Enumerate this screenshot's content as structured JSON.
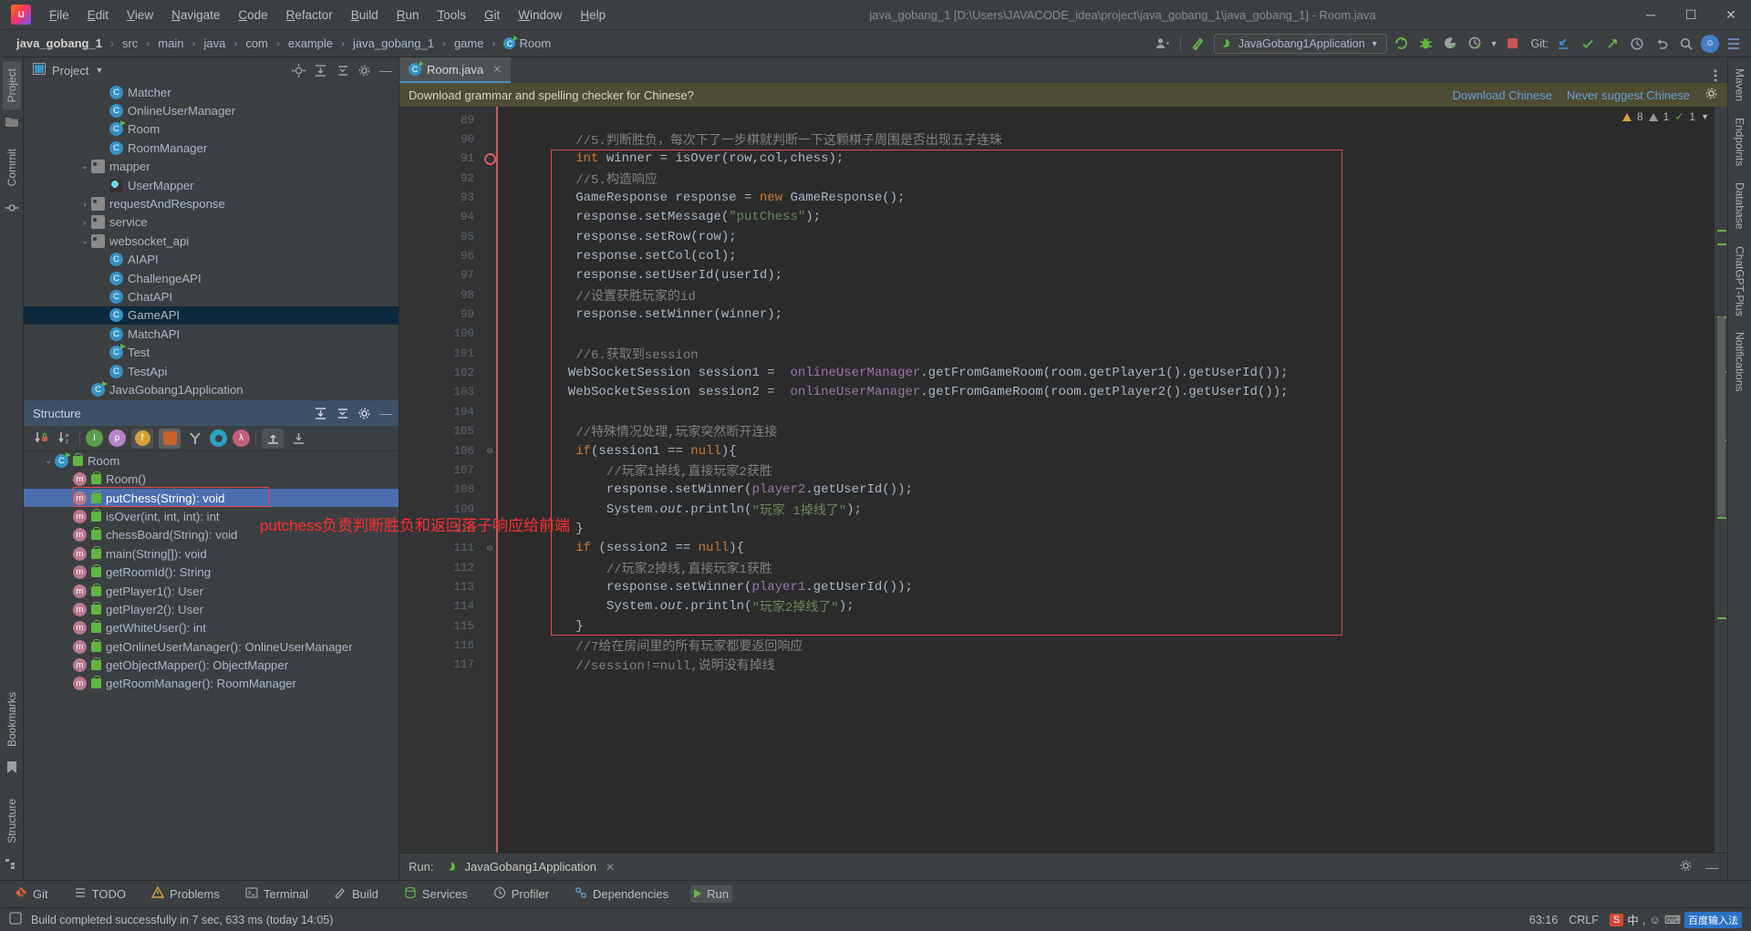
{
  "titlebar": {
    "logo": "intellij-idea-logo",
    "menus": [
      "File",
      "Edit",
      "View",
      "Navigate",
      "Code",
      "Refactor",
      "Build",
      "Run",
      "Tools",
      "Git",
      "Window",
      "Help"
    ],
    "window_title": "java_gobang_1 [D:\\Users\\JAVACODE_idea\\project\\java_gobang_1\\java_gobang_1] - Room.java",
    "minimize": "─",
    "maximize": "☐",
    "close": "✕"
  },
  "navbar": {
    "breadcrumbs": [
      "java_gobang_1",
      "src",
      "main",
      "java",
      "com",
      "example",
      "java_gobang_1",
      "game",
      "Room"
    ],
    "separator": "›",
    "run_config": "JavaGobang1Application",
    "git_label": "Git:",
    "avatar_initial": "☺"
  },
  "project_panel": {
    "title": "Project",
    "items": [
      {
        "label": "Matcher",
        "icon": "class-icon",
        "indent": 4,
        "chevron": ""
      },
      {
        "label": "OnlineUserManager",
        "icon": "class-icon",
        "indent": 4,
        "chevron": ""
      },
      {
        "label": "Room",
        "icon": "class-runnable-icon",
        "indent": 4,
        "chevron": ""
      },
      {
        "label": "RoomManager",
        "icon": "class-icon",
        "indent": 4,
        "chevron": ""
      },
      {
        "label": "mapper",
        "icon": "folder-icon",
        "indent": 3,
        "chevron": "⌄"
      },
      {
        "label": "UserMapper",
        "icon": "mapper-icon",
        "indent": 4,
        "chevron": ""
      },
      {
        "label": "requestAndResponse",
        "icon": "folder-icon",
        "indent": 3,
        "chevron": "›"
      },
      {
        "label": "service",
        "icon": "folder-icon",
        "indent": 3,
        "chevron": "›"
      },
      {
        "label": "websocket_api",
        "icon": "folder-icon",
        "indent": 3,
        "chevron": "⌄"
      },
      {
        "label": "AIAPI",
        "icon": "class-icon",
        "indent": 4,
        "chevron": ""
      },
      {
        "label": "ChallengeAPI",
        "icon": "class-icon",
        "indent": 4,
        "chevron": ""
      },
      {
        "label": "ChatAPI",
        "icon": "class-icon",
        "indent": 4,
        "chevron": ""
      },
      {
        "label": "GameAPI",
        "icon": "class-icon",
        "indent": 4,
        "chevron": "",
        "selected": true
      },
      {
        "label": "MatchAPI",
        "icon": "class-icon",
        "indent": 4,
        "chevron": ""
      },
      {
        "label": "Test",
        "icon": "class-runnable-icon",
        "indent": 4,
        "chevron": ""
      },
      {
        "label": "TestApi",
        "icon": "class-icon",
        "indent": 4,
        "chevron": ""
      },
      {
        "label": "JavaGobang1Application",
        "icon": "spring-class-icon",
        "indent": 3,
        "chevron": ""
      }
    ]
  },
  "structure_panel": {
    "title": "Structure",
    "toolbar_icons": [
      "sort-by-visibility-icon",
      "sort-alphabetically-icon",
      "show-inherited-icon",
      "show-properties-icon",
      "show-fields-icon",
      "show-non-public-icon",
      "group-by-icon",
      "show-interfaces-icon",
      "show-lambdas-icon",
      "expand-all-icon",
      "collapse-all-icon"
    ],
    "items": [
      {
        "label": "Room",
        "icon": "class-runnable-icon",
        "indent": 1,
        "chevron": "⌄",
        "lock": true
      },
      {
        "label": "Room()",
        "icon": "method-icon",
        "indent": 2,
        "lock": true
      },
      {
        "label": "putChess(String): void",
        "icon": "method-icon",
        "indent": 2,
        "lock": true,
        "selected": true,
        "highlight_box": true
      },
      {
        "label": "isOver(int, int, int): int",
        "icon": "method-icon",
        "indent": 2,
        "lock": true
      },
      {
        "label": "chessBoard(String): void",
        "icon": "method-icon",
        "indent": 2,
        "lock": true
      },
      {
        "label": "main(String[]): void",
        "icon": "method-icon",
        "indent": 2,
        "lock": true
      },
      {
        "label": "getRoomId(): String",
        "icon": "method-icon",
        "indent": 2,
        "lock": true
      },
      {
        "label": "getPlayer1(): User",
        "icon": "method-icon",
        "indent": 2,
        "lock": true
      },
      {
        "label": "getPlayer2(): User",
        "icon": "method-icon",
        "indent": 2,
        "lock": true
      },
      {
        "label": "getWhiteUser(): int",
        "icon": "method-icon",
        "indent": 2,
        "lock": true
      },
      {
        "label": "getOnlineUserManager(): OnlineUserManager",
        "icon": "method-icon",
        "indent": 2,
        "lock": true
      },
      {
        "label": "getObjectMapper(): ObjectMapper",
        "icon": "method-icon",
        "indent": 2,
        "lock": true
      },
      {
        "label": "getRoomManager(): RoomManager",
        "icon": "method-icon",
        "indent": 2,
        "lock": true
      }
    ]
  },
  "left_strip": {
    "tabs": [
      "Project",
      "Commit",
      "Bookmarks",
      "Structure"
    ]
  },
  "right_strip": {
    "tabs": [
      "Maven",
      "Endpoints",
      "Database",
      "ChatGPT-Plus",
      "Notifications"
    ]
  },
  "editor": {
    "tab_label": "Room.java",
    "tab_close": "✕",
    "notification": {
      "message": "Download grammar and spelling checker for Chinese?",
      "action_primary": "Download Chinese",
      "action_secondary": "Never suggest Chinese"
    },
    "inspections": {
      "warnings": "8",
      "weak_warnings": "1",
      "typos": "1"
    },
    "first_line_number": 89,
    "breakpoint_line": 91,
    "lines": [
      {
        "n": 89,
        "text": ""
      },
      {
        "n": 90,
        "text": "        //5.判断胜负，每次下了一步棋就判断一下这颗棋子周围是否出现五子连珠",
        "cls": "cmt"
      },
      {
        "n": 91,
        "text": "        int winner = isOver(row,col,chess);",
        "tokens": [
          {
            "t": "        ",
            "c": ""
          },
          {
            "t": "int",
            "c": "kw"
          },
          {
            "t": " winner = isOver(row,col,chess);",
            "c": ""
          }
        ]
      },
      {
        "n": 92,
        "text": "        //5.构造响应",
        "cls": "cmt"
      },
      {
        "n": 93,
        "text": "        GameResponse response = new GameResponse();",
        "tokens": [
          {
            "t": "        GameResponse response = ",
            "c": ""
          },
          {
            "t": "new",
            "c": "kw"
          },
          {
            "t": " GameResponse();",
            "c": ""
          }
        ]
      },
      {
        "n": 94,
        "text": "        response.setMessage(\"putChess\");",
        "tokens": [
          {
            "t": "        response.setMessage(",
            "c": ""
          },
          {
            "t": "\"putChess\"",
            "c": "str"
          },
          {
            "t": ");",
            "c": ""
          }
        ]
      },
      {
        "n": 95,
        "text": "        response.setRow(row);"
      },
      {
        "n": 96,
        "text": "        response.setCol(col);"
      },
      {
        "n": 97,
        "text": "        response.setUserId(userId);"
      },
      {
        "n": 98,
        "text": "        //设置获胜玩家的id",
        "cls": "cmt"
      },
      {
        "n": 99,
        "text": "        response.setWinner(winner);"
      },
      {
        "n": 100,
        "text": ""
      },
      {
        "n": 101,
        "text": "        //6.获取到session",
        "cls": "cmt"
      },
      {
        "n": 102,
        "text": "        WebSocketSession session1 =  onlineUserManager.getFromGameRoom(room.getPlayer1().getUserId());",
        "tokens": [
          {
            "t": "       WebSocketSession session1 =  ",
            "c": ""
          },
          {
            "t": "onlineUserManager",
            "c": "fld"
          },
          {
            "t": ".getFromGameRoom(room.getPlayer1().getUserId());",
            "c": ""
          }
        ]
      },
      {
        "n": 103,
        "text": "        WebSocketSession session2 =  onlineUserManager.getFromGameRoom(room.getPlayer2().getUserId());",
        "tokens": [
          {
            "t": "       WebSocketSession session2 =  ",
            "c": ""
          },
          {
            "t": "onlineUserManager",
            "c": "fld"
          },
          {
            "t": ".getFromGameRoom(room.getPlayer2().getUserId());",
            "c": ""
          }
        ]
      },
      {
        "n": 104,
        "text": ""
      },
      {
        "n": 105,
        "text": "        //特殊情况处理,玩家突然断开连接",
        "cls": "cmt"
      },
      {
        "n": 106,
        "text": "        if(session1 == null){",
        "tokens": [
          {
            "t": "        ",
            "c": ""
          },
          {
            "t": "if",
            "c": "kw"
          },
          {
            "t": "(session1 == ",
            "c": ""
          },
          {
            "t": "null",
            "c": "kw"
          },
          {
            "t": "){",
            "c": ""
          }
        ],
        "fold": "⊖"
      },
      {
        "n": 107,
        "text": "            //玩家1掉线,直接玩家2获胜",
        "cls": "cmt"
      },
      {
        "n": 108,
        "text": "            response.setWinner(player2.getUserId());",
        "tokens": [
          {
            "t": "            response.setWinner(",
            "c": ""
          },
          {
            "t": "player2",
            "c": "fld"
          },
          {
            "t": ".getUserId());",
            "c": ""
          }
        ]
      },
      {
        "n": 109,
        "text": "            System.out.println(\"玩家 1掉线了\");",
        "tokens": [
          {
            "t": "            System.",
            "c": ""
          },
          {
            "t": "out",
            "c": "stc"
          },
          {
            "t": ".println(",
            "c": ""
          },
          {
            "t": "\"玩家 1掉线了\"",
            "c": "str"
          },
          {
            "t": ");",
            "c": ""
          }
        ]
      },
      {
        "n": 110,
        "text": "        }"
      },
      {
        "n": 111,
        "text": "        if (session2 == null){",
        "tokens": [
          {
            "t": "        ",
            "c": ""
          },
          {
            "t": "if",
            "c": "kw"
          },
          {
            "t": " (session2 == ",
            "c": ""
          },
          {
            "t": "null",
            "c": "kw"
          },
          {
            "t": "){",
            "c": ""
          }
        ],
        "fold": "⊖"
      },
      {
        "n": 112,
        "text": "            //玩家2掉线,直接玩家1获胜",
        "cls": "cmt"
      },
      {
        "n": 113,
        "text": "            response.setWinner(player1.getUserId());",
        "tokens": [
          {
            "t": "            response.setWinner(",
            "c": ""
          },
          {
            "t": "player1",
            "c": "fld"
          },
          {
            "t": ".getUserId());",
            "c": ""
          }
        ]
      },
      {
        "n": 114,
        "text": "            System.out.println(\"玩家2掉线了\");",
        "tokens": [
          {
            "t": "            System.",
            "c": ""
          },
          {
            "t": "out",
            "c": "stc"
          },
          {
            "t": ".println(",
            "c": ""
          },
          {
            "t": "\"玩家2掉线了\"",
            "c": "str"
          },
          {
            "t": ");",
            "c": ""
          }
        ]
      },
      {
        "n": 115,
        "text": "        }"
      },
      {
        "n": 116,
        "text": "        //7给在房间里的所有玩家都要返回响应",
        "cls": "cmt"
      },
      {
        "n": 117,
        "text": "        //session!=null,说明没有掉线",
        "cls": "cmt"
      }
    ]
  },
  "annotation": {
    "text": "putchess负责判断胜负和返回落子响应给前端",
    "color": "#ff2d2d"
  },
  "run_panel": {
    "label": "Run:",
    "tab": "JavaGobang1Application",
    "close": "✕"
  },
  "bottom_toolwindows": [
    {
      "label": "Git",
      "icon": "git-icon"
    },
    {
      "label": "TODO",
      "icon": "todo-icon"
    },
    {
      "label": "Problems",
      "icon": "problems-icon"
    },
    {
      "label": "Terminal",
      "icon": "terminal-icon"
    },
    {
      "label": "Build",
      "icon": "build-icon"
    },
    {
      "label": "Services",
      "icon": "services-icon"
    },
    {
      "label": "Profiler",
      "icon": "profiler-icon"
    },
    {
      "label": "Dependencies",
      "icon": "dependencies-icon"
    },
    {
      "label": "Run",
      "icon": "run-icon",
      "active": true
    }
  ],
  "statusbar": {
    "message": "Build completed successfully in 7 sec, 633 ms (today 14:05)",
    "caret_position": "63:16",
    "line_separator": "CRLF",
    "ime_s": "S",
    "ime_cn": "中",
    "ime_extra": "百度输入法"
  }
}
